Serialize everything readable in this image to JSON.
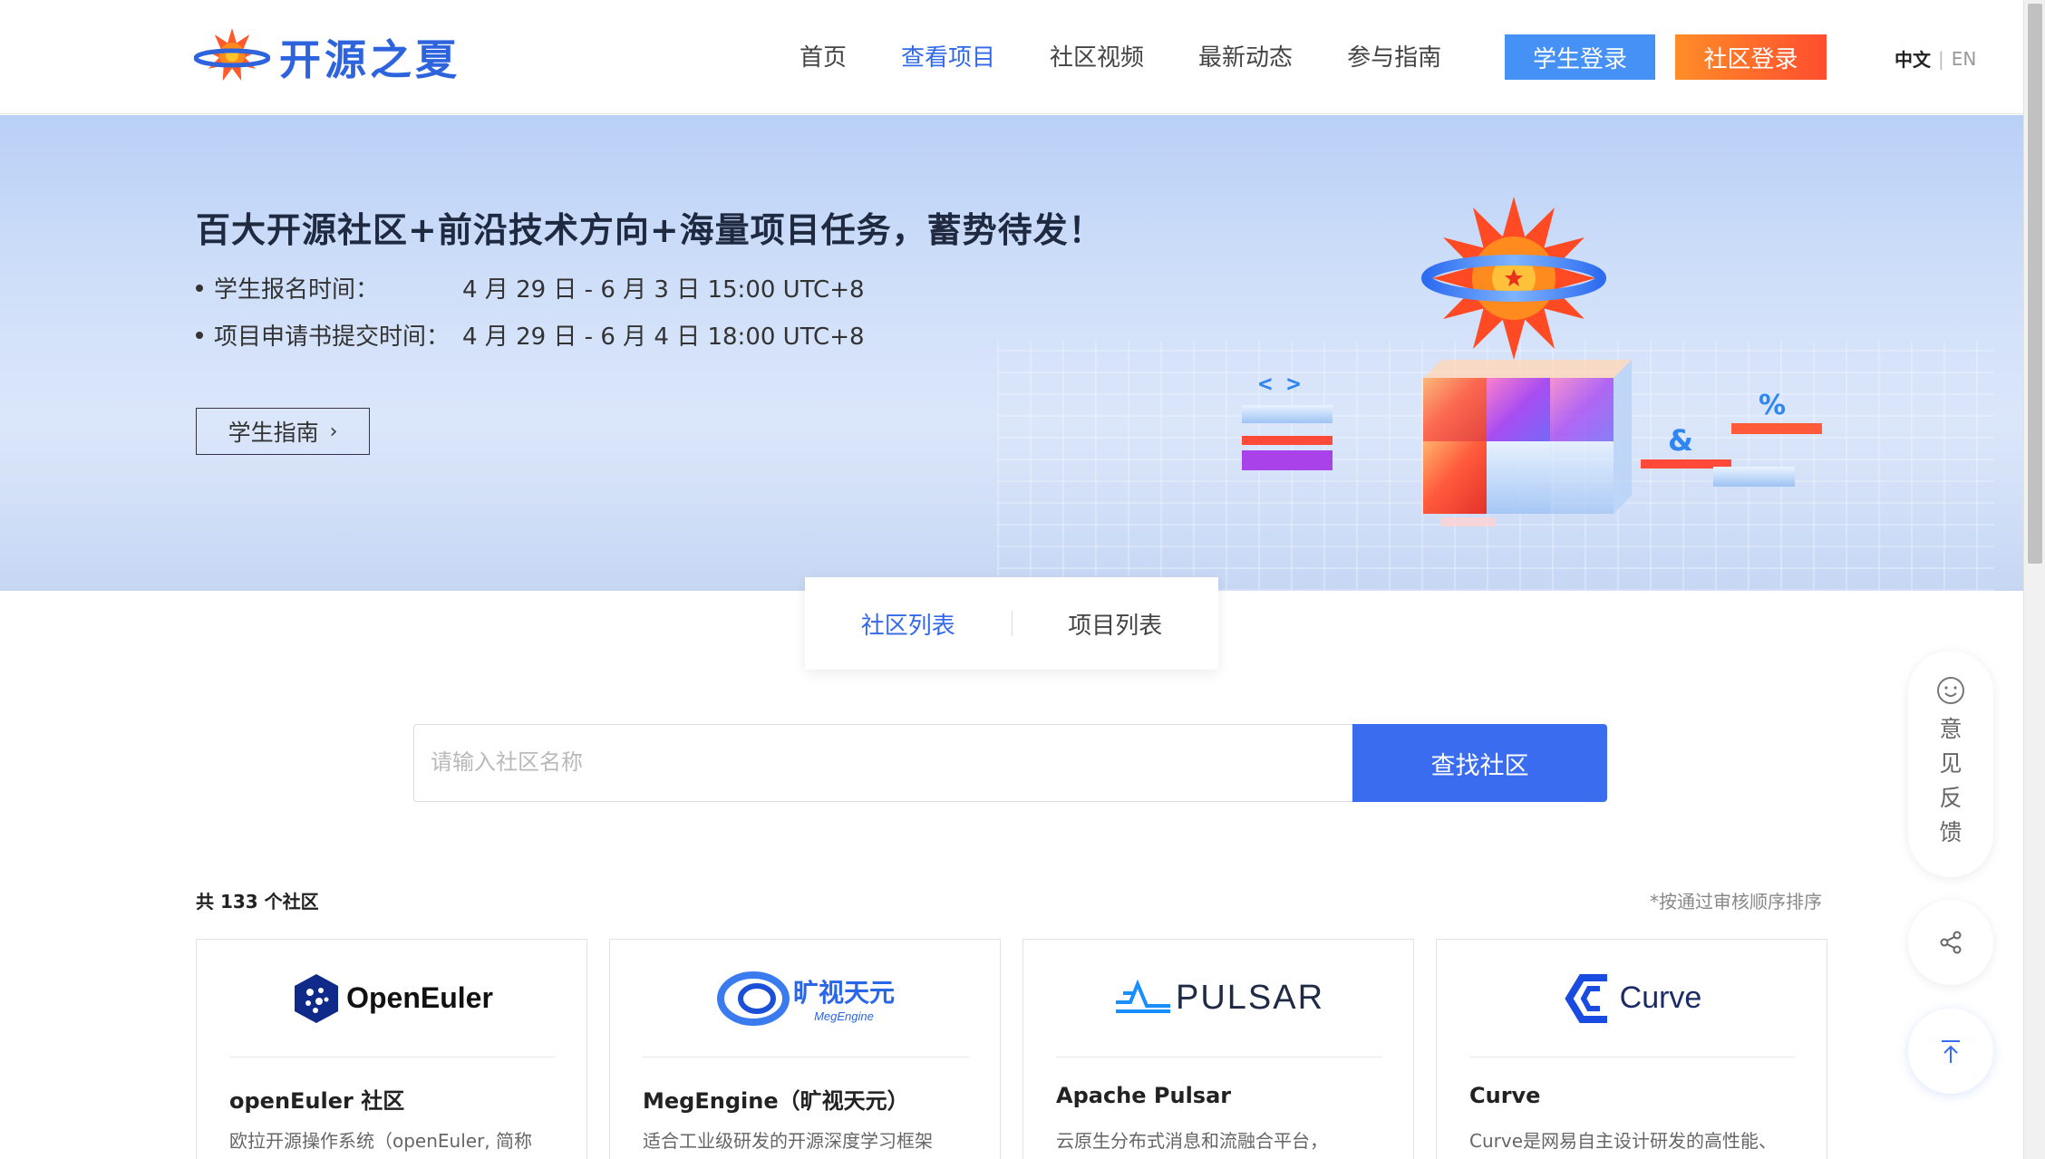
{
  "header": {
    "logo_text": "开源之夏",
    "nav": [
      "首页",
      "查看项目",
      "社区视频",
      "最新动态",
      "参与指南"
    ],
    "active_nav": "查看项目",
    "student_login": "学生登录",
    "community_login": "社区登录",
    "lang_zh": "中文",
    "lang_sep": "|",
    "lang_en": "EN"
  },
  "banner": {
    "title": "百大开源社区+前沿技术方向+海量项目任务，蓄势待发！",
    "rows": [
      {
        "label": "学生报名时间：",
        "value": "4 月 29 日 - 6 月 3 日 15:00 UTC+8"
      },
      {
        "label": "项目申请书提交时间：",
        "value": "4 月 29 日 - 6 月 4 日 18:00 UTC+8"
      }
    ],
    "guide_button": "学生指南",
    "symbols": [
      "< >",
      "&",
      "%"
    ]
  },
  "tabs": [
    "社区列表",
    "项目列表"
  ],
  "search": {
    "placeholder": "请输入社区名称",
    "button": "查找社区"
  },
  "count_text": "共 133 个社区",
  "sort_note": "*按通过审核顺序排序",
  "cards": [
    {
      "logo_text": "OpenEuler",
      "name": "openEuler 社区",
      "desc": "欧拉开源操作系统（openEuler, 简称"
    },
    {
      "logo_text": "旷视天元",
      "logo_sub": "MegEngine",
      "name": "MegEngine（旷视天元）",
      "desc": "适合工业级研发的开源深度学习框架"
    },
    {
      "logo_text": "PULSAR",
      "name": "Apache Pulsar",
      "desc": "云原生分布式消息和流融合平台，"
    },
    {
      "logo_text": "Curve",
      "name": "Curve",
      "desc": "Curve是网易自主设计研发的高性能、"
    }
  ],
  "side": {
    "feedback": [
      "意",
      "见",
      "反",
      "馈"
    ]
  },
  "colors": {
    "primary": "#3a6cf0",
    "student_btn": "#4691f6",
    "community_btn_from": "#ff8d28",
    "community_btn_to": "#ff4d2e"
  },
  "icons": [
    "flower-logo-icon",
    "chevron-right-icon",
    "smile-icon",
    "share-icon",
    "arrow-up-icon"
  ]
}
